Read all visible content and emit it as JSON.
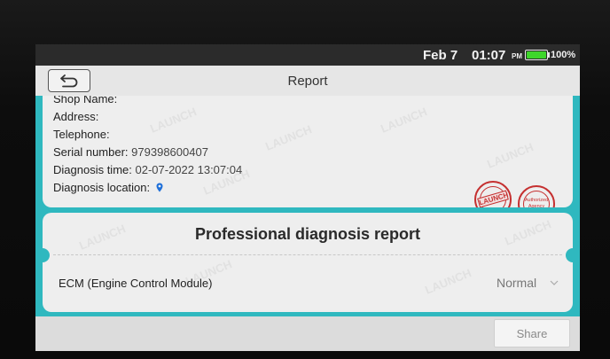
{
  "status_bar": {
    "date": "Feb 7",
    "time": "01:07",
    "ampm": "PM",
    "battery": "100%",
    "battery_level": 1.0,
    "battery_color": "#3ed62b"
  },
  "header": {
    "back_icon": "back-arrow-icon",
    "title": "Report"
  },
  "shop_info": {
    "shop_name_label": "Shop Name:",
    "address_label": "Address:",
    "telephone_label": "Telephone:",
    "serial_label": "Serial number:",
    "serial_value": "979398600407",
    "diag_time_label": "Diagnosis time:",
    "diag_time_value": "02-07-2022 13:07:04",
    "diag_location_label": "Diagnosis location:",
    "location_icon": "location-pin-icon",
    "stamps": [
      {
        "name": "launch-stamp",
        "text": "LAUNCH"
      },
      {
        "name": "authorized-agency-stamp",
        "text": "Authorized Agency"
      }
    ]
  },
  "report": {
    "title": "Professional diagnosis report",
    "modules": [
      {
        "name": "ECM (Engine Control Module)",
        "status": "Normal",
        "expand_icon": "chevron-down-icon"
      }
    ]
  },
  "footer": {
    "share_label": "Share"
  },
  "watermark": "LAUNCH",
  "colors": {
    "accent": "#2fb8bf",
    "card": "#eeeeee",
    "stamp": "#c53030",
    "location_pin": "#1e6fd9"
  }
}
